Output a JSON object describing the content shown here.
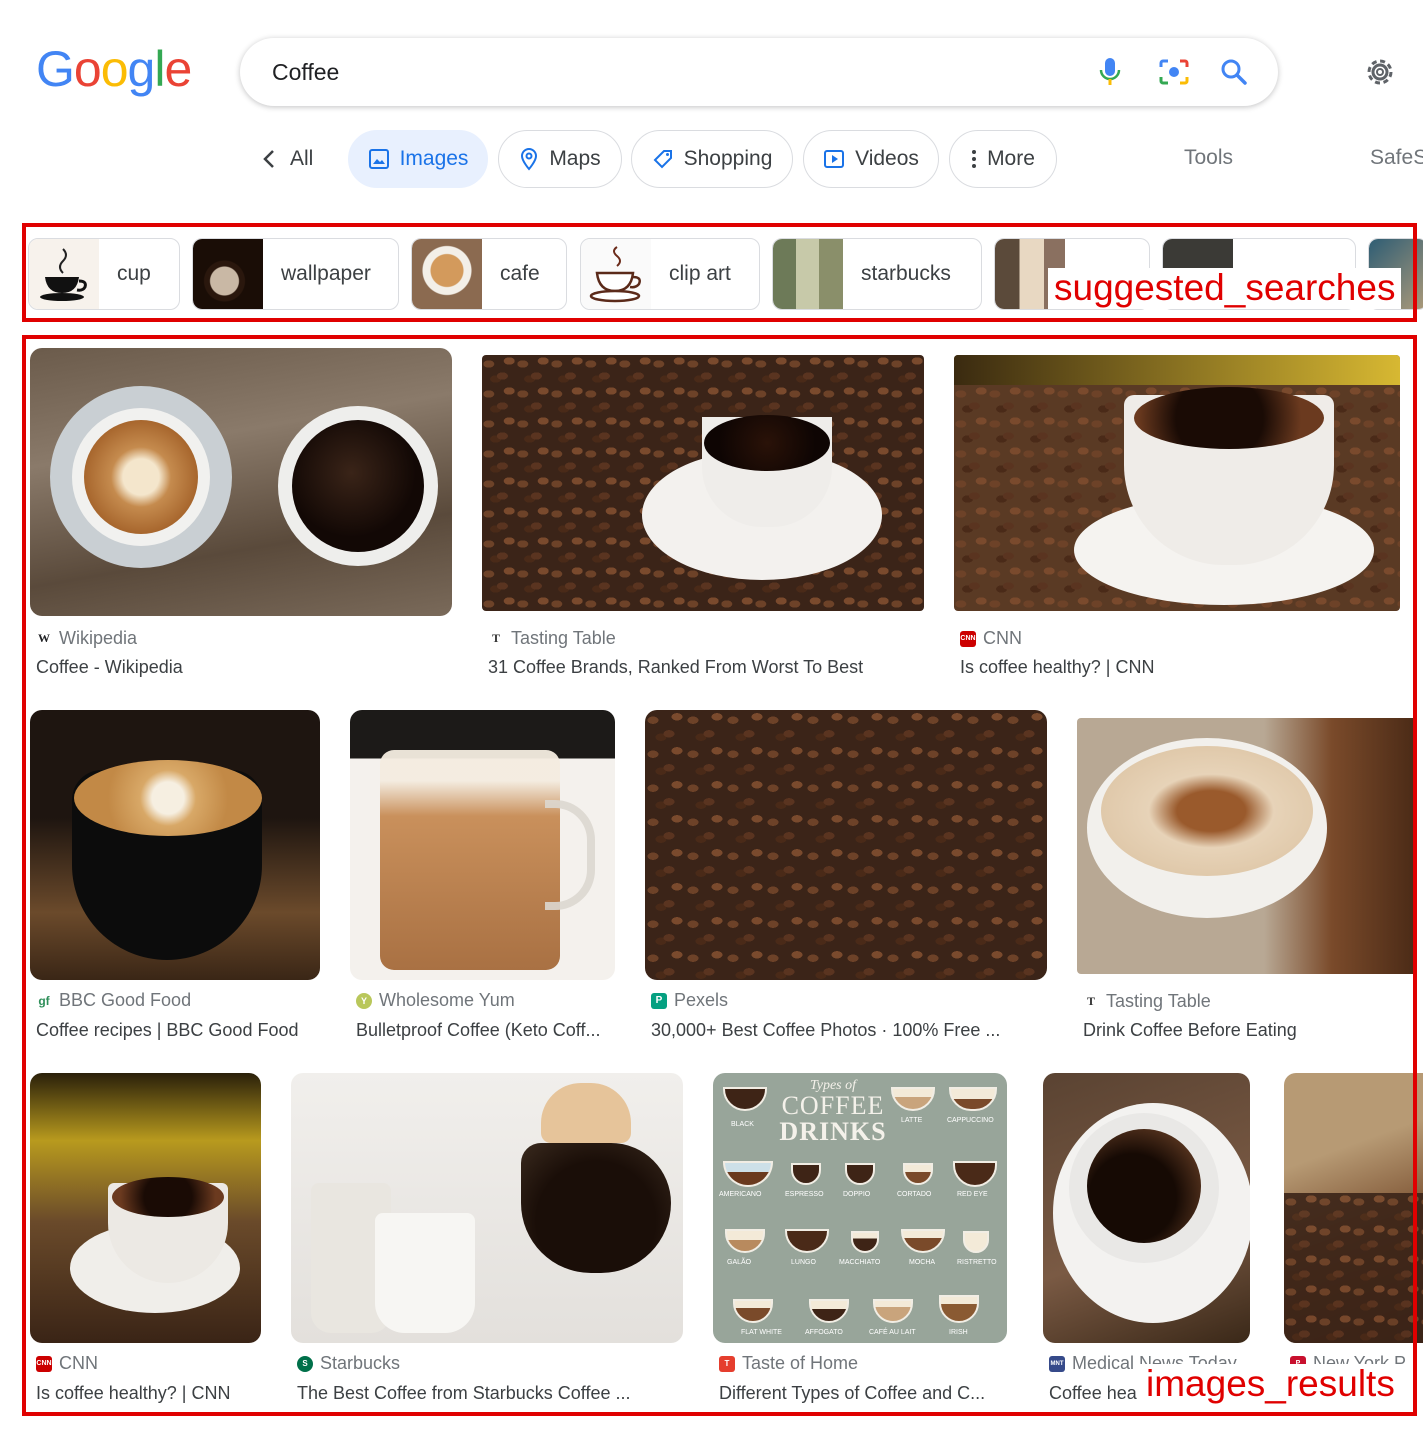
{
  "header": {
    "logo_letters": [
      {
        "ch": "G",
        "color": "#4285F4"
      },
      {
        "ch": "o",
        "color": "#EA4335"
      },
      {
        "ch": "o",
        "color": "#FBBC05"
      },
      {
        "ch": "g",
        "color": "#4285F4"
      },
      {
        "ch": "l",
        "color": "#34A853"
      },
      {
        "ch": "e",
        "color": "#EA4335"
      }
    ],
    "query": "Coffee",
    "icons": [
      "microphone-icon",
      "camera-lens-icon",
      "search-icon",
      "gear-icon"
    ]
  },
  "tabs": {
    "all": "All",
    "images": "Images",
    "maps": "Maps",
    "shopping": "Shopping",
    "videos": "Videos",
    "more": "More",
    "tools": "Tools",
    "safesearch": "SafeS"
  },
  "annotations": {
    "suggested": "suggested_searches",
    "results": "images_results",
    "color": "#e00000"
  },
  "suggested_searches": [
    {
      "label": "cup"
    },
    {
      "label": "wallpaper"
    },
    {
      "label": "cafe"
    },
    {
      "label": "clip art"
    },
    {
      "label": "starbucks"
    },
    {
      "label": ""
    },
    {
      "label": ""
    },
    {
      "label": ""
    }
  ],
  "results": [
    {
      "source": "Wikipedia",
      "title": "Coffee - Wikipedia"
    },
    {
      "source": "Tasting Table",
      "title": "31 Coffee Brands, Ranked From Worst To Best"
    },
    {
      "source": "CNN",
      "title": "Is coffee healthy? | CNN"
    },
    {
      "source": "BBC Good Food",
      "title": "Coffee recipes | BBC Good Food"
    },
    {
      "source": "Wholesome Yum",
      "title": "Bulletproof Coffee (Keto Coff..."
    },
    {
      "source": "Pexels",
      "title": "30,000+ Best Coffee Photos · 100% Free ..."
    },
    {
      "source": "Tasting Table",
      "title": "Drink Coffee Before Eating"
    },
    {
      "source": "CNN",
      "title": "Is coffee healthy? | CNN"
    },
    {
      "source": "Starbucks",
      "title": "The Best Coffee from Starbucks Coffee ..."
    },
    {
      "source": "Taste of Home",
      "title": "Different Types of Coffee and C..."
    },
    {
      "source": "Medical News Today",
      "title": "Coffee hea"
    },
    {
      "source": "New York P",
      "title": "C"
    }
  ],
  "infographic": {
    "title_line1": "Types of",
    "title_line2": "COFFEE",
    "title_line3": "DRINKS",
    "drinks": [
      "BLACK",
      "LATTE",
      "CAPPUCCINO",
      "AMERICANO",
      "ESPRESSO",
      "DOPPIO",
      "CORTADO",
      "RED EYE",
      "GALÃO",
      "LUNGO",
      "MACCHIATO",
      "MOCHA",
      "RISTRETTO",
      "FLAT WHITE",
      "AFFOGATO",
      "CAFÉ AU LAIT",
      "IRISH"
    ]
  }
}
